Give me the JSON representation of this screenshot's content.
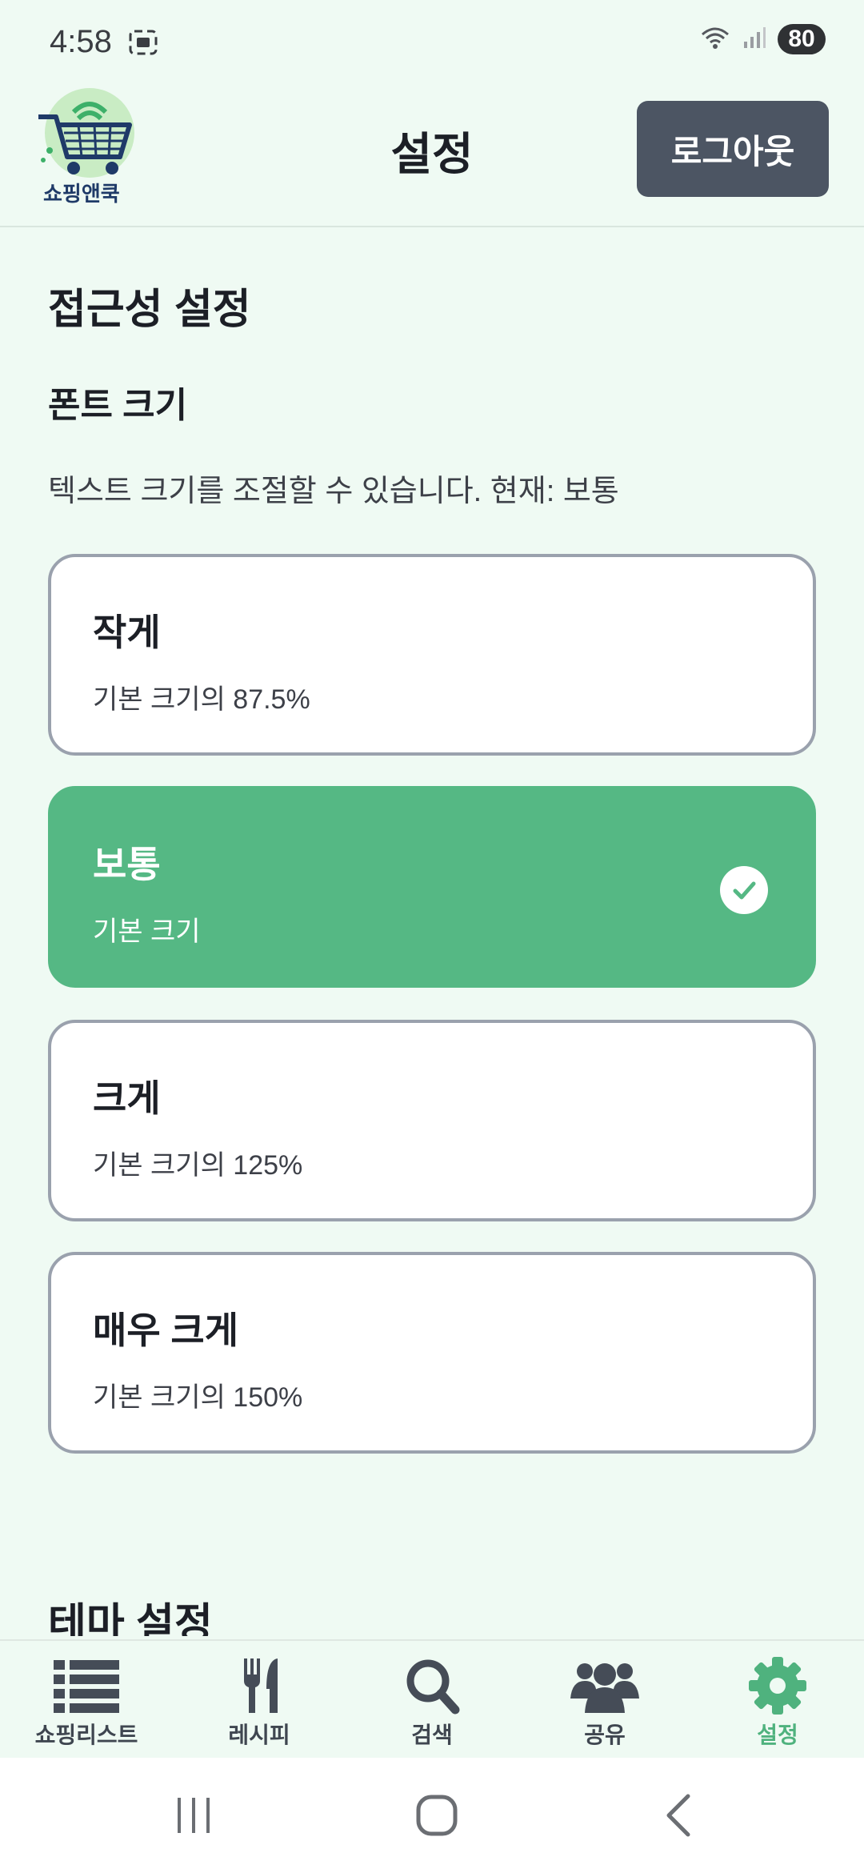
{
  "status_bar": {
    "time": "4:58",
    "battery": "80"
  },
  "header": {
    "logo_text": "쇼핑앤쿡",
    "title": "설정",
    "logout_label": "로그아웃"
  },
  "accessibility": {
    "section_title": "접근성 설정",
    "font_size_title": "폰트 크기",
    "description": "텍스트 크기를 조절할 수 있습니다. 현재: 보통",
    "options": [
      {
        "name": "작게",
        "info": "기본 크기의 87.5%",
        "selected": false
      },
      {
        "name": "보통",
        "info": "기본 크기",
        "selected": true
      },
      {
        "name": "크게",
        "info": "기본 크기의 125%",
        "selected": false
      },
      {
        "name": "매우 크게",
        "info": "기본 크기의 150%",
        "selected": false
      }
    ]
  },
  "theme": {
    "section_title": "테마 설정"
  },
  "bottom_nav": [
    {
      "label": "쇼핑리스트",
      "icon": "list-icon",
      "active": false
    },
    {
      "label": "레시피",
      "icon": "fork-knife-icon",
      "active": false
    },
    {
      "label": "검색",
      "icon": "search-icon",
      "active": false
    },
    {
      "label": "공유",
      "icon": "users-icon",
      "active": false
    },
    {
      "label": "설정",
      "icon": "gear-icon",
      "active": true
    }
  ],
  "colors": {
    "background": "#effaf3",
    "accent": "#55b884",
    "logout_button": "#4c5563",
    "active_nav": "#4fb27e"
  }
}
